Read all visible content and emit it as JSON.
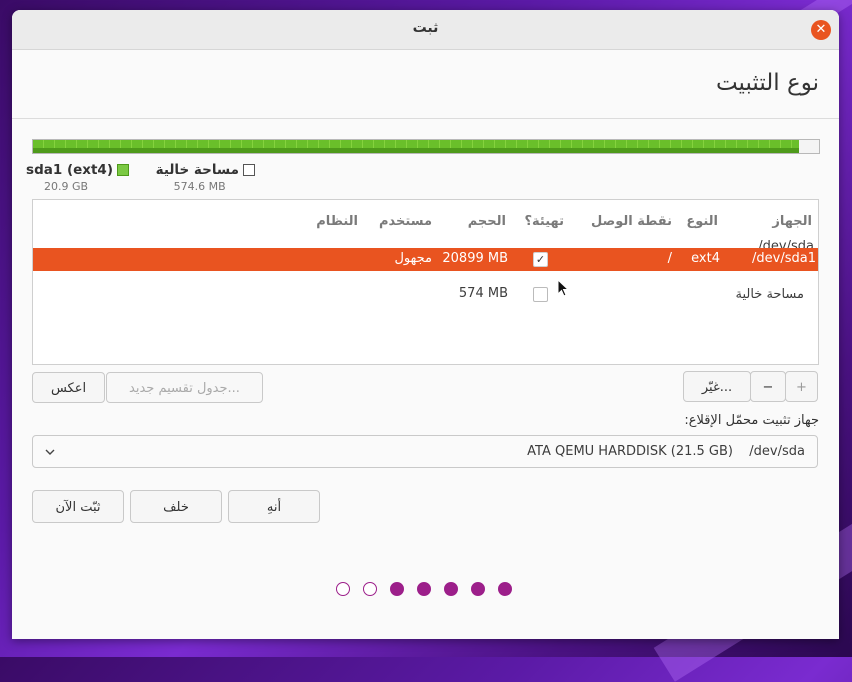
{
  "window": {
    "title": "ثبت"
  },
  "page": {
    "title": "نوع التثبيت"
  },
  "usage": {
    "used_fraction": 0.974,
    "partitions": [
      {
        "name": "sda1 (ext4)",
        "size": "20.9 GB",
        "color": "#7bc943"
      },
      {
        "name": "مساحة خالية",
        "size": "574.6 MB",
        "color": "#ffffff"
      }
    ]
  },
  "table": {
    "headers": {
      "device": "الجهاز",
      "type": "النوع",
      "mount": "نقطة الوصل",
      "format": "تهيئة؟",
      "size": "الحجم",
      "used": "مستخدم",
      "system": "النظام"
    },
    "disk_row": {
      "device": "/dev/sda"
    },
    "rows": [
      {
        "device": "/dev/sda1",
        "type": "ext4",
        "mount": "/",
        "format": true,
        "size": "20899 MB",
        "used": "مجهول",
        "system": ""
      },
      {
        "device": "مساحة خالية",
        "type": "",
        "mount": "",
        "format": false,
        "size": "574 MB",
        "used": "",
        "system": ""
      }
    ]
  },
  "controls": {
    "add": "+",
    "remove": "−",
    "change": "غيّر...",
    "new_table": "جدول تقسيم جديد...",
    "revert": "اعكس"
  },
  "bootloader": {
    "label": "جهاز تثبيت محمّل الإقلاع:",
    "device": "/dev/sda",
    "description": "ATA QEMU HARDDISK (21.5 GB)"
  },
  "buttons": {
    "quit": "أنهِ",
    "back": "خلف",
    "install_now": "ثبّت الآن"
  },
  "progress": {
    "total_steps": 7,
    "completed_steps": 5
  },
  "colors": {
    "accent": "#e95420",
    "progress": "#9c1f8a",
    "used_partition": "#7bc943"
  }
}
